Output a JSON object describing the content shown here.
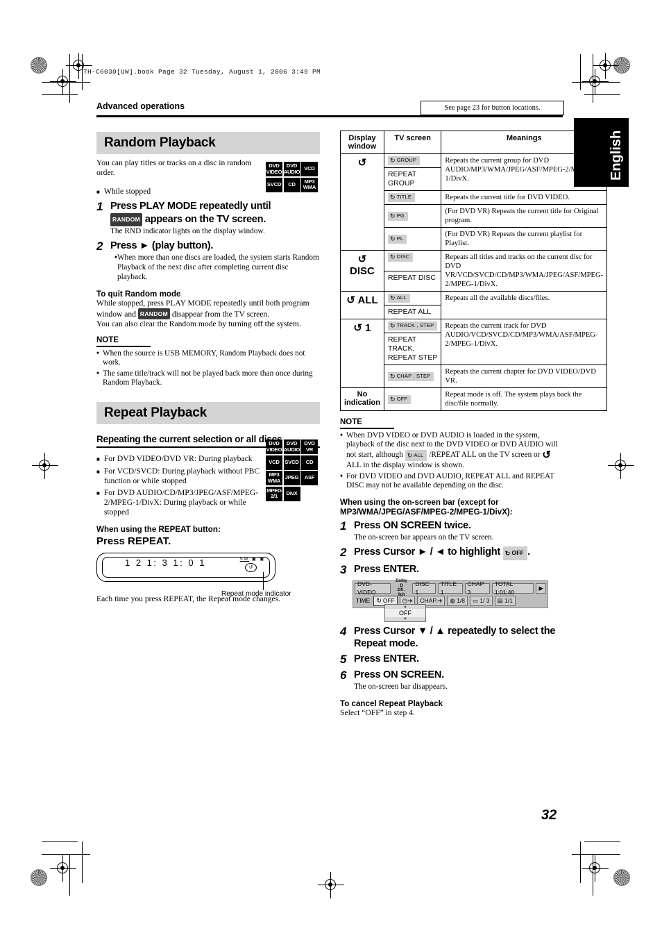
{
  "header": {
    "book_line": "TH-C6030[UW].book  Page 32  Tuesday, August 1, 2006  3:49 PM",
    "breadcrumb": "Advanced operations",
    "see_page_note": "See page 23 for button locations.",
    "language_tab": "English",
    "page_number": "32"
  },
  "random": {
    "title": "Random Playback",
    "intro": "You can play titles or tracks on a disc in random order.",
    "condition": "While stopped",
    "discs": [
      "DVD VIDEO",
      "DVD AUDIO",
      "VCD",
      "SVCD",
      "CD",
      "MP3 WMA"
    ],
    "steps": [
      {
        "num": "1",
        "text_before": "Press PLAY MODE repeatedly until",
        "chip": "RANDOM",
        "text_after": "appears on the TV screen.",
        "desc": "The RND indicator lights on the display window."
      },
      {
        "num": "2",
        "text_before": "Press ► (play button).",
        "desc": "When more than one discs are loaded, the system starts Random Playback of the next disc after completing current disc playback."
      }
    ],
    "quit_heading": "To quit Random mode",
    "quit_line1a": "While stopped, press PLAY MODE repeatedly until both program window and",
    "quit_chip": "RANDOM",
    "quit_line1b": "disappear from the TV screen.",
    "quit_line2": "You can also clear the Random mode by turning off the system.",
    "note_heading": "NOTE",
    "notes": [
      "When the source is USB MEMORY, Random Playback does not work.",
      "The same title/track will not be played back more than once during Random Playback."
    ]
  },
  "repeat": {
    "title": "Repeat Playback",
    "subheading": "Repeating the current selection or all discs",
    "conditions": [
      "For DVD VIDEO/DVD VR: During playback",
      "For VCD/SVCD: During playback without PBC function or while stopped",
      "For DVD AUDIO/CD/MP3/JPEG/ASF/MPEG-2/MPEG-1/DivX: During playback or while stopped"
    ],
    "discs": [
      "DVD VIDEO",
      "DVD AUDIO",
      "DVD VR",
      "VCD",
      "SVCD",
      "CD",
      "MP3 WMA",
      "JPEG",
      "ASF",
      "MPEG 2/1",
      "DivX"
    ],
    "button_label": "When using the REPEAT button:",
    "press_label": "Press REPEAT.",
    "display_window": {
      "numbers": "1 2   1: 3 1: 0 1",
      "indicators": "SW",
      "repeat_glyph": "↺",
      "callout": "Repeat mode indicator"
    },
    "each_time": "Each time you press REPEAT, the Repeat mode changes."
  },
  "table": {
    "headers": [
      "Display window",
      "TV screen",
      "Meanings"
    ],
    "rows": [
      {
        "display": "↺",
        "display_rowspan": 4,
        "chip": "GROUP",
        "rpt": "REPEAT GROUP",
        "meaning": "Repeats the current group for DVD AUDIO/MP3/WMA/JPEG/ASF/MPEG-2/MPEG-1/DivX."
      },
      {
        "chip": "TITLE",
        "rpt": "",
        "meaning": "Repeats the current title for DVD VIDEO."
      },
      {
        "chip": "PG",
        "rpt": "",
        "meaning": "(For DVD VR) Repeats the current title for Original program."
      },
      {
        "chip": "PL",
        "rpt": "",
        "meaning": "(For DVD VR) Repeats the current playlist for Playlist."
      },
      {
        "display": "↺ DISC",
        "display_rowspan": 1,
        "chip": "DISC",
        "rpt": "REPEAT DISC",
        "meaning": "Repeats all titles and tracks on the current disc for DVD VR/VCD/SVCD/CD/MP3/WMA/JPEG/ASF/MPEG-2/MPEG-1/DivX."
      },
      {
        "display": "↺ ALL",
        "display_rowspan": 1,
        "chip": "ALL",
        "rpt": "REPEAT ALL",
        "meaning": "Repeats all the available discs/files."
      },
      {
        "display": "↺ 1",
        "display_rowspan": 2,
        "chip": "TRACK , STEP",
        "rpt": "REPEAT TRACK, REPEAT STEP",
        "meaning": "Repeats the current track for DVD AUDIO/VCD/SVCD/CD/MP3/WMA/ASF/MPEG-2/MPEG-1/DivX."
      },
      {
        "chip": "CHAP , STEP",
        "rpt": "",
        "meaning": "Repeats the current chapter for DVD VIDEO/DVD VR."
      },
      {
        "display": "No indication",
        "display_rowspan": 1,
        "chip": "OFF",
        "rpt": "",
        "meaning": "Repeat mode is off. The system plays back the disc/file normally."
      }
    ]
  },
  "right_note": {
    "heading": "NOTE",
    "item1a": "When DVD VIDEO or DVD AUDIO is loaded in the system, playback of the disc next to the DVD VIDEO or DVD AUDIO will not start, although",
    "item1_chip": "ALL",
    "item1b": "/REPEAT ALL on the TV screen or",
    "item1c": "ALL in the display window is shown.",
    "item2": "For DVD VIDEO and DVD AUDIO, REPEAT ALL and REPEAT DISC may not be available depending on the disc."
  },
  "onscreen": {
    "heading": "When using the on-screen bar (except for MP3/WMA/JPEG/ASF/MPEG-2/MPEG-1/DivX):",
    "steps": [
      {
        "num": "1",
        "text": "Press ON SCREEN twice.",
        "desc": "The on-screen bar appears on the TV screen."
      },
      {
        "num": "2",
        "text_before": "Press Cursor ► / ◄ to highlight",
        "chip": "OFF",
        "text_after": "."
      },
      {
        "num": "3",
        "text": "Press ENTER."
      },
      {
        "num": "4",
        "text": "Press Cursor ▼ / ▲ repeatedly to select the Repeat mode."
      },
      {
        "num": "5",
        "text": "Press ENTER."
      },
      {
        "num": "6",
        "text": "Press ON SCREEN.",
        "desc": "The on-screen bar disappears."
      }
    ],
    "bar": {
      "disc_type": "DVD-VIDEO",
      "audio_line1": "Dolby D",
      "audio_line2": "2/0 . 0ch",
      "disc": "DISC 1",
      "title": "TITLE 1",
      "chapter": "CHAP  3",
      "total": "TOTAL   1:01:40",
      "next_arrow": "▶",
      "time_label": "TIME",
      "repeat_cell": "OFF",
      "clock_cell": "➜",
      "chap_cell": "CHAP.➜",
      "audio_cell": "1/8",
      "subtitle_cell": "1/ 3",
      "angle_cell": "1/1",
      "dropdown_value": "OFF"
    },
    "cancel_heading": "To cancel Repeat Playback",
    "cancel_text": "Select “OFF” in step 4."
  }
}
